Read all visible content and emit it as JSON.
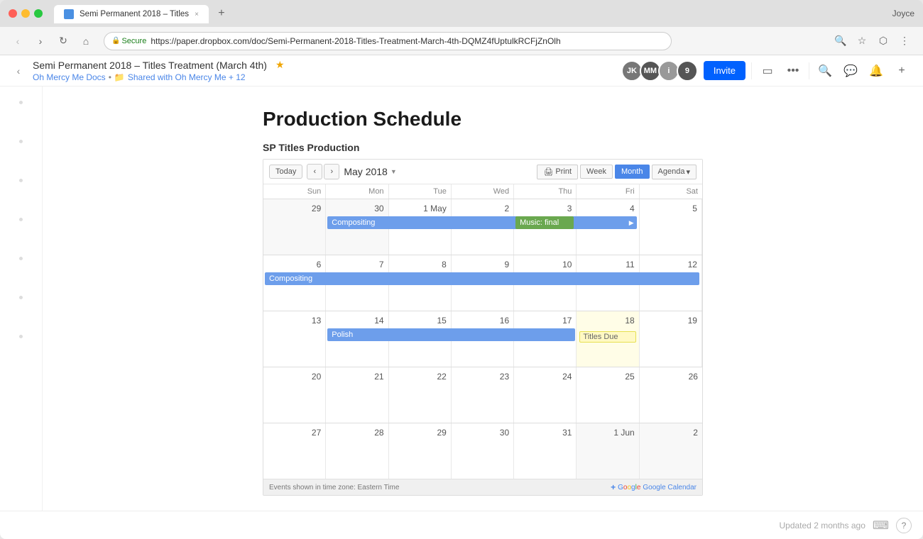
{
  "browser": {
    "tab_title": "Semi Permanent 2018 – Titles",
    "tab_close": "×",
    "user_name": "Joyce",
    "url_secure": "Secure",
    "url": "https://paper.dropbox.com/doc/Semi-Permanent-2018-Titles-Treatment-March-4th-DQMZ4fUptulkRCFjZnOlh",
    "nav_back": "‹",
    "nav_forward": "›",
    "nav_refresh": "↺",
    "nav_home": "⌂"
  },
  "doc_toolbar": {
    "back_btn": "‹",
    "title": "Semi Permanent 2018 – Titles Treatment (March 4th)",
    "star": "★",
    "breadcrumb_root": "Oh Mercy Me Docs",
    "breadcrumb_sep1": "•",
    "breadcrumb_folder": "Shared with Oh Mercy Me + 12",
    "invite_label": "Invite",
    "avatar1_initials": "JK",
    "avatar1_color": "#888",
    "avatar2_initials": "MM",
    "avatar2_color": "#666",
    "avatar3_initials": "i",
    "avatar3_color": "#999",
    "avatar_count": "9"
  },
  "document": {
    "heading": "Production Schedule",
    "calendar_section_title": "SP Titles Production"
  },
  "calendar": {
    "today_btn": "Today",
    "prev_btn": "‹",
    "next_btn": "›",
    "month_label": "May 2018",
    "print_btn": "Print",
    "week_btn": "Week",
    "month_btn": "Month",
    "agenda_btn": "Agenda",
    "day_headers": [
      "Sun",
      "Mon",
      "Tue",
      "Wed",
      "Thu",
      "Fri",
      "Sat"
    ],
    "weeks": [
      {
        "days": [
          {
            "num": "29",
            "other": true
          },
          {
            "num": "30",
            "other": true
          },
          {
            "num": "1",
            "label": "1 May"
          },
          {
            "num": "2"
          },
          {
            "num": "3"
          },
          {
            "num": "4"
          },
          {
            "num": "5"
          }
        ],
        "span_events": [
          {
            "label": "Compositing",
            "start_col": 1,
            "span": 6,
            "type": "blue",
            "has_arrow": true
          }
        ],
        "cell_events": [
          {
            "col": 4,
            "label": "Music: final",
            "type": "green-solid"
          }
        ]
      },
      {
        "days": [
          {
            "num": "6"
          },
          {
            "num": "7"
          },
          {
            "num": "8"
          },
          {
            "num": "9"
          },
          {
            "num": "10"
          },
          {
            "num": "11"
          },
          {
            "num": "12"
          }
        ],
        "span_events": [
          {
            "label": "Compositing",
            "start_col": 0,
            "span": 7,
            "type": "blue"
          }
        ],
        "cell_events": []
      },
      {
        "days": [
          {
            "num": "13"
          },
          {
            "num": "14"
          },
          {
            "num": "15"
          },
          {
            "num": "16"
          },
          {
            "num": "17"
          },
          {
            "num": "18",
            "today": true
          },
          {
            "num": "19"
          }
        ],
        "span_events": [
          {
            "label": "Polish",
            "start_col": 1,
            "span": 5,
            "type": "blue"
          }
        ],
        "cell_events": [
          {
            "col": 5,
            "label": "Titles Due",
            "type": "yellow-outline"
          }
        ]
      },
      {
        "days": [
          {
            "num": "20"
          },
          {
            "num": "21"
          },
          {
            "num": "22"
          },
          {
            "num": "23"
          },
          {
            "num": "24"
          },
          {
            "num": "25"
          },
          {
            "num": "26"
          }
        ],
        "span_events": [],
        "cell_events": []
      },
      {
        "days": [
          {
            "num": "27"
          },
          {
            "num": "28"
          },
          {
            "num": "29"
          },
          {
            "num": "30"
          },
          {
            "num": "31"
          },
          {
            "num": "1 Jun",
            "other": true
          },
          {
            "num": "2",
            "other": true
          }
        ],
        "span_events": [],
        "cell_events": []
      }
    ],
    "footer_timezone": "Events shown in time zone: Eastern Time",
    "google_cal_label": "Google Calendar"
  },
  "status_bar": {
    "updated_text": "Updated 2 months ago"
  }
}
